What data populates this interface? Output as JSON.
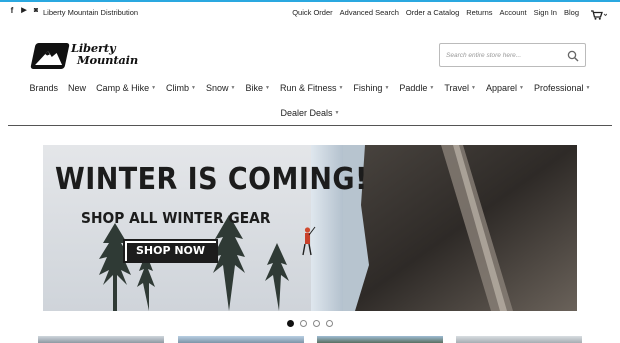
{
  "topbar": {
    "social": [
      {
        "icon": "facebook-icon",
        "glyph": "f"
      },
      {
        "icon": "youtube-icon",
        "glyph": "▶"
      },
      {
        "icon": "instagram-icon",
        "glyph": "◙"
      }
    ],
    "brand": "Liberty Mountain Distribution",
    "links": [
      "Quick Order",
      "Advanced Search",
      "Order a Catalog",
      "Returns",
      "Account",
      "Sign In",
      "Blog"
    ],
    "cart_icon": "cart-icon"
  },
  "logo": {
    "line1": "Liberty",
    "line2": "Mountain"
  },
  "search": {
    "placeholder": "Search entire store here...",
    "button_icon": "search-icon"
  },
  "nav": {
    "items": [
      {
        "label": "Brands",
        "caret": false
      },
      {
        "label": "New",
        "caret": false
      },
      {
        "label": "Camp & Hike",
        "caret": true
      },
      {
        "label": "Climb",
        "caret": true
      },
      {
        "label": "Snow",
        "caret": true
      },
      {
        "label": "Bike",
        "caret": true
      },
      {
        "label": "Run & Fitness",
        "caret": true
      },
      {
        "label": "Fishing",
        "caret": true
      },
      {
        "label": "Paddle",
        "caret": true
      },
      {
        "label": "Travel",
        "caret": true
      },
      {
        "label": "Apparel",
        "caret": true
      },
      {
        "label": "Professional",
        "caret": true
      }
    ],
    "row2": {
      "label": "Dealer Deals",
      "caret": true
    }
  },
  "hero": {
    "headline": "WINTER IS COMING!",
    "subhead": "SHOP ALL WINTER GEAR",
    "cta": "SHOP NOW"
  },
  "carousel": {
    "slide_count": 4,
    "active_index": 0
  },
  "colors": {
    "accent": "#2aa8e0",
    "text": "#222222",
    "hero_text": "#1c1c1c"
  }
}
